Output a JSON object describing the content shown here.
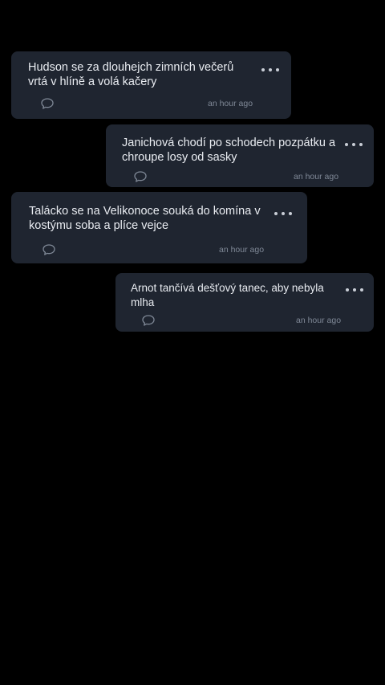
{
  "icons": {
    "more": "more-horizontal-icon",
    "comment": "comment-bubble-icon"
  },
  "colors": {
    "background": "#000000",
    "card": "#1f2530",
    "text": "#e9ecf1",
    "meta": "#7f8896"
  },
  "messages": [
    {
      "text": "Hudson se za dlouhejch zimních večerů vrtá v hlíně a volá kačery",
      "time": "an hour ago"
    },
    {
      "text": "Janichová chodí po schodech pozpátku a chroupe losy od sasky",
      "time": "an hour ago"
    },
    {
      "text": "Talácko se na Velikonoce souká do komína v kostýmu soba a plíce vejce",
      "time": "an hour ago"
    },
    {
      "text": "Arnot tančívá dešťový tanec, aby nebyla mlha",
      "time": "an hour ago"
    }
  ]
}
